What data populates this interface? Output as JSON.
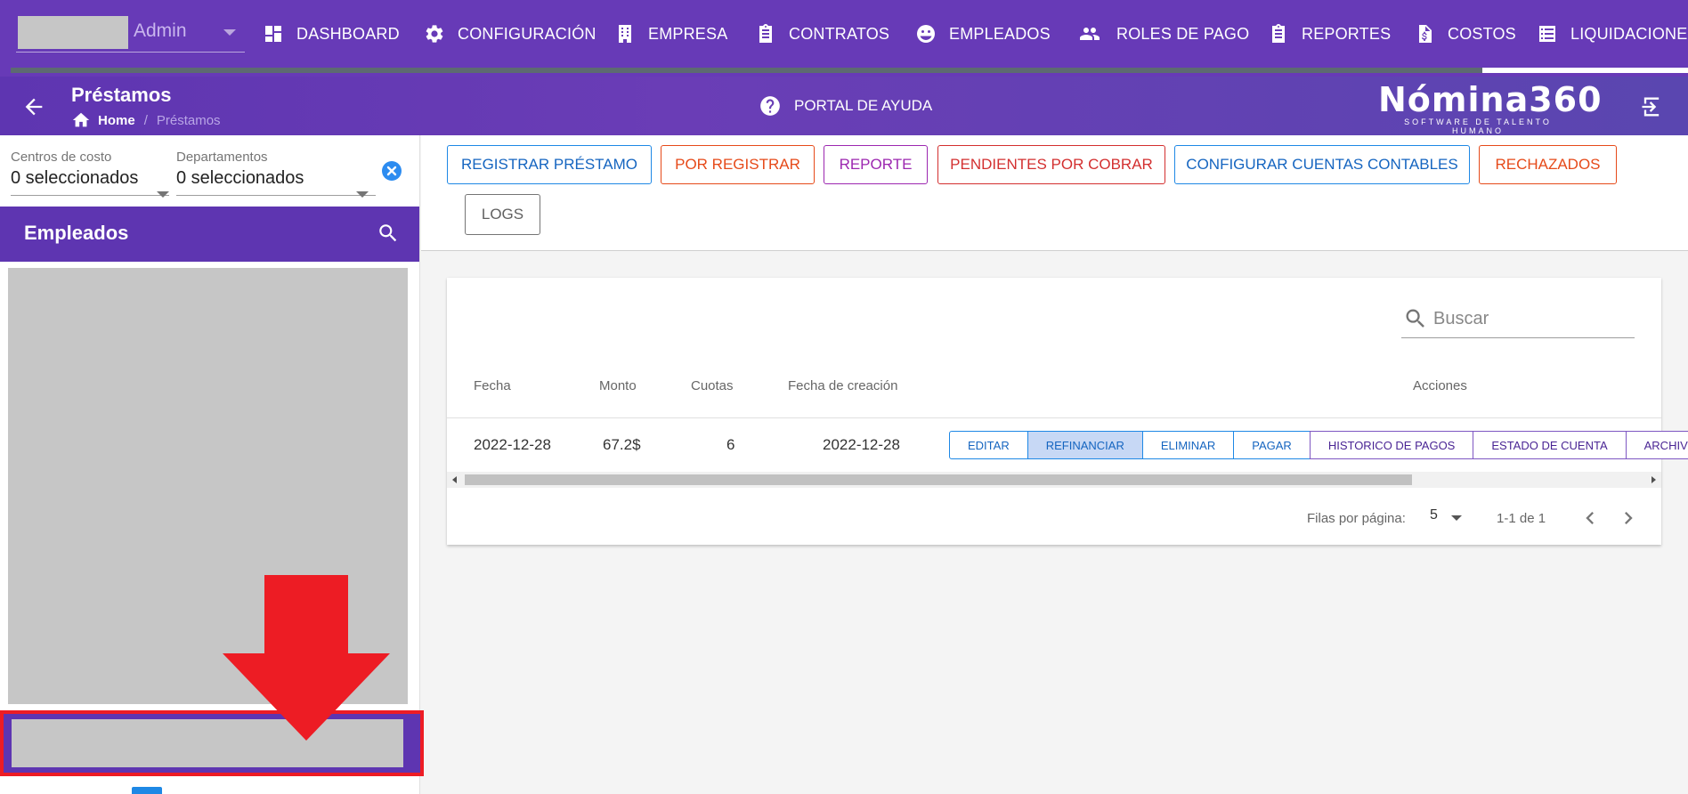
{
  "topnav": {
    "user": {
      "name": "Admin"
    },
    "items": [
      {
        "label": "DASHBOARD",
        "icon": "dashboard-icon"
      },
      {
        "label": "CONFIGURACIÓN",
        "icon": "gear-icon"
      },
      {
        "label": "EMPRESA",
        "icon": "building-icon"
      },
      {
        "label": "CONTRATOS",
        "icon": "clipboard-icon"
      },
      {
        "label": "EMPLEADOS",
        "icon": "face-icon"
      },
      {
        "label": "ROLES DE PAGO",
        "icon": "people-icon"
      },
      {
        "label": "REPORTES",
        "icon": "clipboard-list-icon"
      },
      {
        "label": "COSTOS",
        "icon": "dollar-document-icon"
      },
      {
        "label": "LIQUIDACIONE",
        "icon": "list-icon"
      }
    ],
    "progress": 0.877
  },
  "header": {
    "title": "Préstamos",
    "breadcrumb": {
      "home": "Home",
      "separator": "/",
      "current": "Préstamos"
    },
    "help_label": "PORTAL DE AYUDA",
    "logo": {
      "title": "Nómina360",
      "subtitle": "SOFTWARE DE TALENTO HUMANO"
    }
  },
  "sidebar": {
    "filters": [
      {
        "label": "Centros de costo",
        "value": "0 seleccionados"
      },
      {
        "label": "Departamentos",
        "value": "0 seleccionados"
      }
    ],
    "employees_title": "Empleados"
  },
  "toolbar": {
    "buttons": [
      {
        "label": "REGISTRAR PRÉSTAMO",
        "color": "#1565c0"
      },
      {
        "label": "POR REGISTRAR",
        "color": "#e64a19"
      },
      {
        "label": "REPORTE",
        "color": "#9c27b0"
      },
      {
        "label": "PENDIENTES POR COBRAR",
        "color": "#d32f2f"
      },
      {
        "label": "CONFIGURAR CUENTAS CONTABLES",
        "color": "#1565c0"
      },
      {
        "label": "RECHAZADOS",
        "color": "#e64a19"
      },
      {
        "label": "LOGS",
        "color": "#616161"
      }
    ]
  },
  "table": {
    "search_placeholder": "Buscar",
    "headers": [
      "Fecha",
      "Monto",
      "Cuotas",
      "Fecha de creación",
      "Acciones"
    ],
    "rows": [
      {
        "fecha": "2022-12-28",
        "monto": "67.2$",
        "cuotas": "6",
        "fecha_creacion": "2022-12-28"
      }
    ],
    "actions": [
      "EDITAR",
      "REFINANCIAR",
      "ELIMINAR",
      "PAGAR",
      "HISTORICO DE PAGOS",
      "ESTADO DE CUENTA",
      "ARCHIVO BA"
    ],
    "footer": {
      "rows_per_page_label": "Filas por página:",
      "rows_per_page": "5",
      "range": "1-1 de 1"
    }
  },
  "colors": {
    "primary": "#673ab7",
    "annotation_red": "#ed1c24"
  }
}
